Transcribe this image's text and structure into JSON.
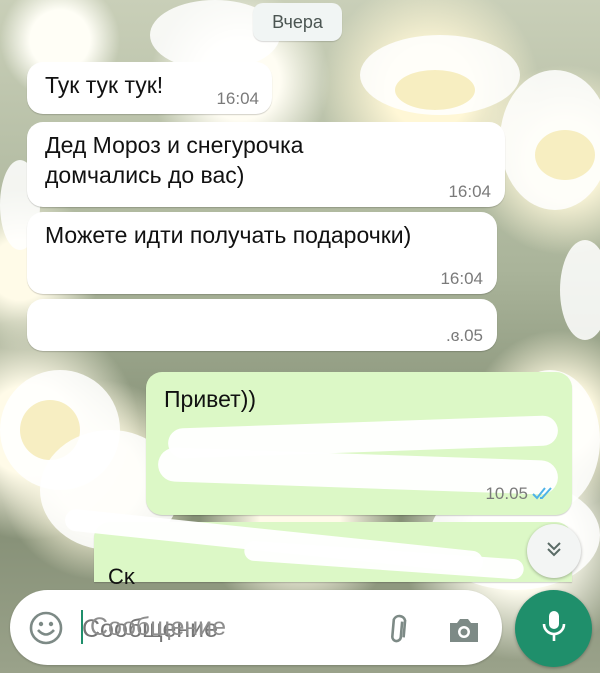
{
  "date_chip": "Вчера",
  "messages_in": [
    {
      "text": "Тук тук тук!",
      "time": "16:04"
    },
    {
      "text": "Дед Мороз и снегурочка домчались до вас)",
      "time": "16:04"
    },
    {
      "text": "Можете идти получать подарочки)",
      "time": "16:04"
    },
    {
      "text": "",
      "time": ".ɞ.05"
    }
  ],
  "message_out": {
    "text": "Привет))",
    "time": "10.05"
  },
  "message_out_partial": {
    "text_fragment": "Cκ"
  },
  "input": {
    "placeholder": "Сообщение",
    "value": ""
  },
  "icons": {
    "emoji": "emoji-icon",
    "attach": "paperclip-icon",
    "camera": "camera-icon",
    "mic": "mic-icon",
    "scroll": "double-chevron-down-icon",
    "ticks": "double-check-icon"
  },
  "colors": {
    "accent": "#1f8f6b",
    "outgoing": "#dcf8c6",
    "read_ticks": "#4fb3e8"
  }
}
